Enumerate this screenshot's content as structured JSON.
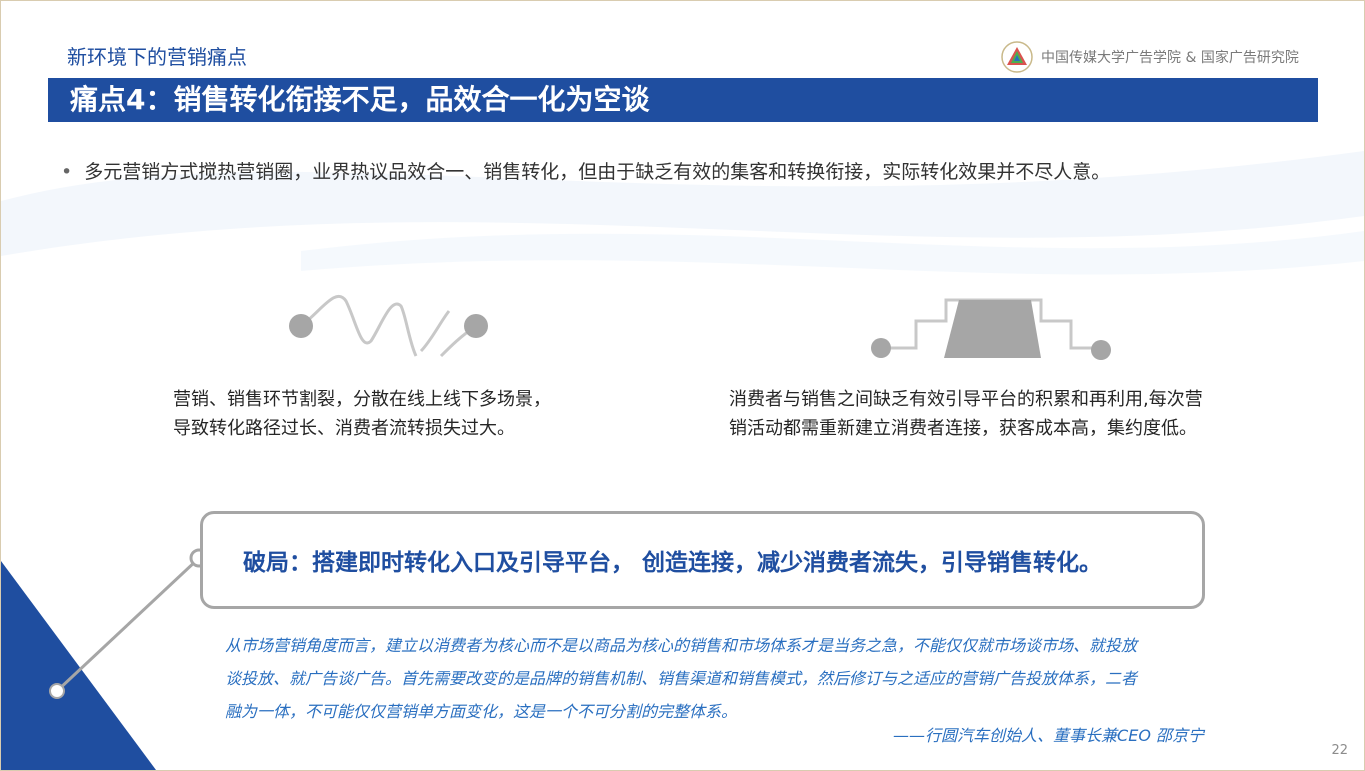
{
  "header": {
    "section_title": "新环境下的营销痛点",
    "org_name": "中国传媒大学广告学院 & 国家广告研究院",
    "logo_icon": "triangle-emblem-icon"
  },
  "title_bar": {
    "text": "痛点4：销售转化衔接不足，品效合一化为空谈",
    "color": "#1f4ea0"
  },
  "bullet": "多元营销方式搅热营销圈，业界热议品效合一、销售转化，但由于缺乏有效的集客和转换衔接，实际转化效果并不尽人意。",
  "pain_points": [
    {
      "icon": "broken-path-icon",
      "lines": [
        "营销、销售环节割裂，分散在线上线下多场景，",
        "导致转化路径过长、消费者流转损失过大。"
      ]
    },
    {
      "icon": "trapezoid-path-icon",
      "lines": [
        "消费者与销售之间缺乏有效引导平台的积累和再利用,每次营",
        "销活动都需重新建立消费者连接，获客成本高，集约度低。"
      ]
    }
  ],
  "callout": {
    "text": "破局：搭建即时转化入口及引导平台， 创造连接，减少消费者流失，引导销售转化。"
  },
  "quote": {
    "lines": [
      "从市场营销角度而言，建立以消费者为核心而不是以商品为核心的销售和市场体系才是当务之急，不能仅仅就市场谈市场、就投放",
      "谈投放、就广告谈广告。首先需要改变的是品牌的销售机制、销售渠道和销售模式，然后修订与之适应的营销广告投放体系，二者",
      "融为一体，不可能仅仅营销单方面变化，这是一个不可分割的完整体系。"
    ],
    "attribution": "——行圆汽车创始人、董事长兼CEO  邵京宁"
  },
  "page_number": "22"
}
